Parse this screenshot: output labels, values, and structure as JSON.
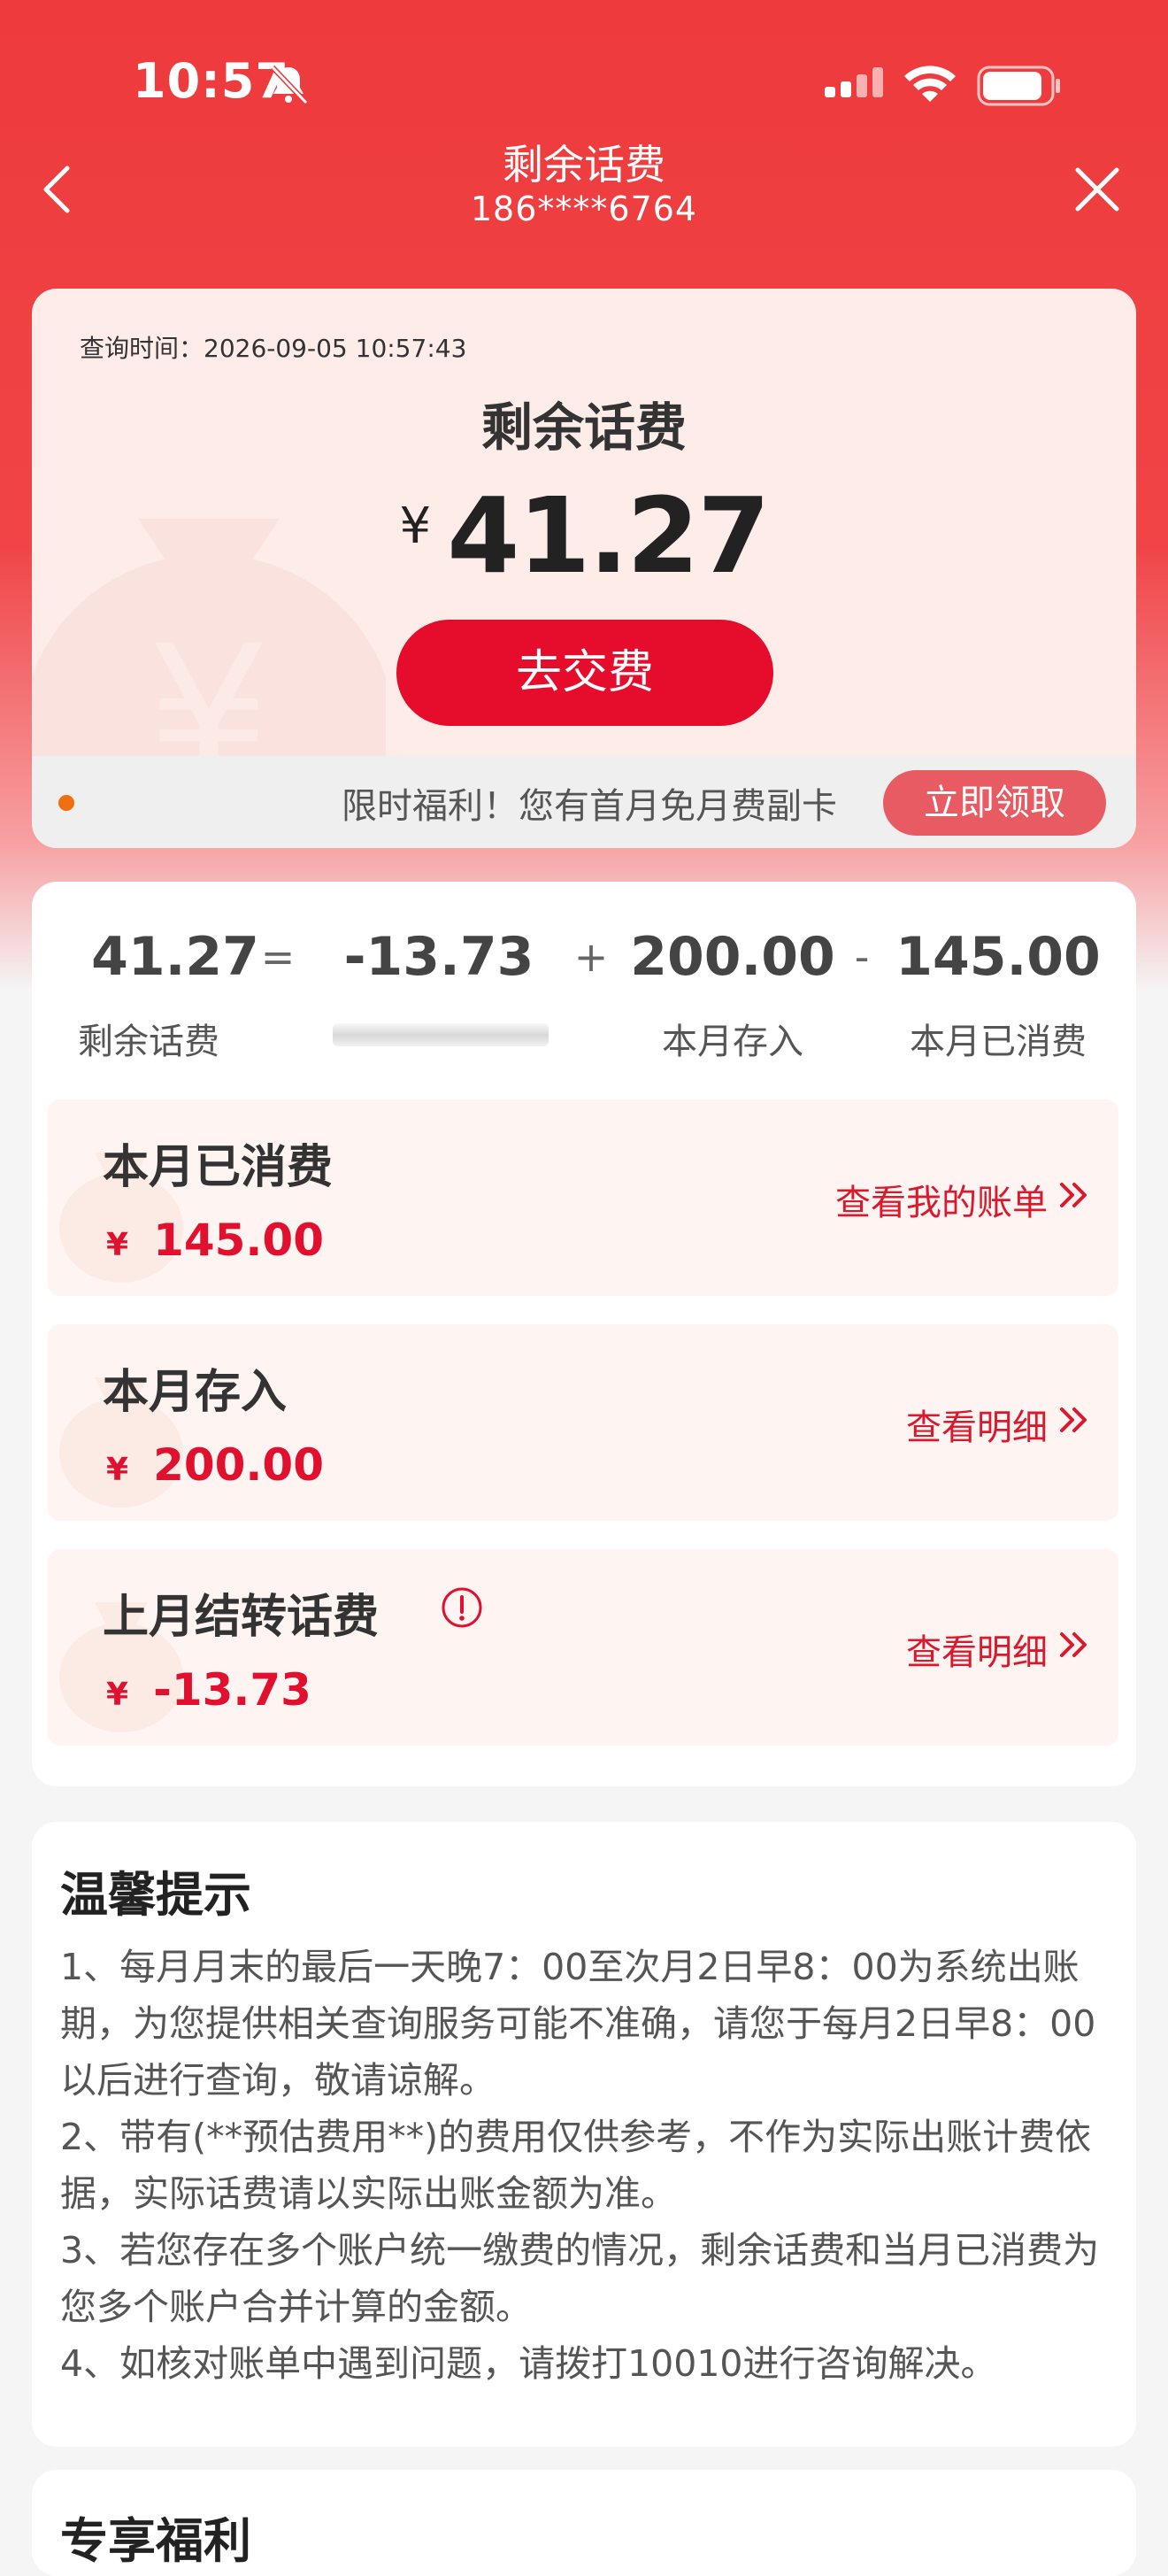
{
  "status_bar": {
    "time": "10:57"
  },
  "nav": {
    "title": "剩余话费",
    "phone": "186****6764"
  },
  "balance": {
    "query_time": "查询时间：2026-09-05 10:57:43",
    "title": "剩余话费",
    "currency": "¥",
    "amount": "41.27",
    "pay_button": "去交费"
  },
  "promo": {
    "text": "限时福利！您有首月免月费副卡",
    "button": "立即领取"
  },
  "equation": {
    "remaining": "41.27",
    "op1": "=",
    "carryover": "-13.73",
    "op2": "+",
    "deposit": "200.00",
    "op3": "-",
    "consumed": "145.00",
    "label_remaining": "剩余话费",
    "label_deposit": "本月存入",
    "label_consumed": "本月已消费"
  },
  "rows": [
    {
      "title": "本月已消费",
      "currency": "¥",
      "amount": "145.00",
      "link": "查看我的账单"
    },
    {
      "title": "本月存入",
      "currency": "¥",
      "amount": "200.00",
      "link": "查看明细"
    },
    {
      "title": "上月结转话费",
      "currency": "¥",
      "amount": "-13.73",
      "link": "查看明细"
    }
  ],
  "tips": {
    "title": "温馨提示",
    "items": [
      "1、每月月末的最后一天晚7：00至次月2日早8：00为系统出账期，为您提供相关查询服务可能不准确，请您于每月2日早8：00以后进行查询，敬请谅解。",
      "2、带有(**预估费用**)的费用仅供参考，不作为实际出账计费依据，实际话费请以实际出账金额为准。",
      "3、若您存在多个账户统一缴费的情况，剩余话费和当月已消费为您多个账户合并计算的金额。",
      "4、如核对账单中遇到问题，请拨打10010进行咨询解决。"
    ]
  },
  "bottom_section": {
    "title": "专享福利"
  },
  "colors": {
    "brand_red": "#e60c2c",
    "header_red": "#ee3a3c",
    "amount_red": "#e0102e"
  },
  "icons": [
    "back-arrow-icon",
    "close-icon",
    "bell-muted-icon",
    "signal-icon",
    "wifi-icon",
    "battery-icon",
    "chevron-double-right-icon",
    "warning-circle-icon",
    "money-bag-icon"
  ]
}
